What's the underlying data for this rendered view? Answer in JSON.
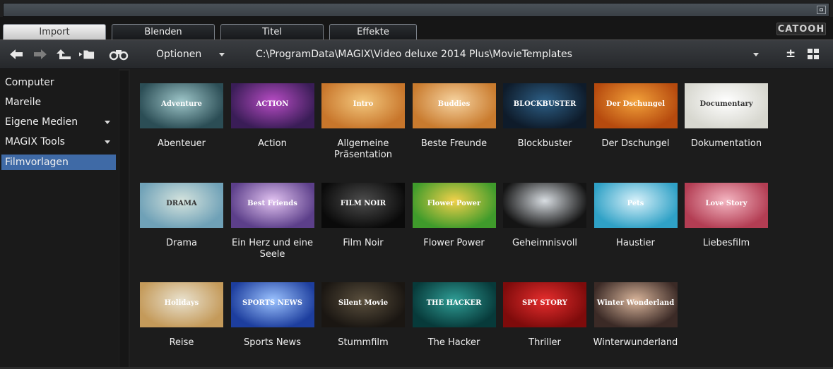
{
  "tabs": [
    "Import",
    "Blenden",
    "Titel",
    "Effekte"
  ],
  "logo": "CATOOH",
  "toolbar": {
    "options_label": "Optionen",
    "path": "C:\\ProgramData\\MAGIX\\Video deluxe 2014 Plus\\MovieTemplates"
  },
  "sidebar": {
    "items": [
      {
        "label": "Computer"
      },
      {
        "label": "Mareile"
      },
      {
        "label": "Eigene Medien"
      },
      {
        "label": "MAGIX Tools"
      },
      {
        "label": "Filmvorlagen"
      }
    ]
  },
  "templates": [
    {
      "caption": "Abenteuer",
      "thumb_text": "Adventure",
      "thumb_colors": [
        "#2b4d55",
        "#9ec6c9"
      ]
    },
    {
      "caption": "Action",
      "thumb_text": "ACTION",
      "thumb_colors": [
        "#3a1d57",
        "#b74cc4"
      ]
    },
    {
      "caption": "Allgemeine Präsentation",
      "thumb_text": "Intro",
      "thumb_colors": [
        "#c8762b",
        "#f3c77d"
      ]
    },
    {
      "caption": "Beste Freunde",
      "thumb_text": "Buddies",
      "thumb_colors": [
        "#c97b2e",
        "#f6d3a0"
      ]
    },
    {
      "caption": "Blockbuster",
      "thumb_text": "BLOCKBUSTER",
      "thumb_colors": [
        "#0e1b2a",
        "#2d5f86"
      ]
    },
    {
      "caption": "Der Dschungel",
      "thumb_text": "Der Dschungel",
      "thumb_colors": [
        "#b64a0e",
        "#f2a13a"
      ]
    },
    {
      "caption": "Dokumentation",
      "thumb_text": "Documentary",
      "thumb_colors": [
        "#d7d7cf",
        "#ffffff"
      ]
    },
    {
      "caption": "Drama",
      "thumb_text": "DRAMA",
      "thumb_colors": [
        "#6fa1b7",
        "#d6e4de"
      ]
    },
    {
      "caption": "Ein Herz und eine Seele",
      "thumb_text": "Best Friends",
      "thumb_colors": [
        "#5c3f8a",
        "#e2c3f1"
      ]
    },
    {
      "caption": "Film Noir",
      "thumb_text": "FILM NOIR",
      "thumb_colors": [
        "#0a0a0a",
        "#4d4d4d"
      ]
    },
    {
      "caption": "Flower Power",
      "thumb_text": "Flower Power",
      "thumb_colors": [
        "#3f9b2b",
        "#f2d14a"
      ]
    },
    {
      "caption": "Geheimnisvoll",
      "thumb_text": "",
      "thumb_colors": [
        "#141414",
        "#d8dde2"
      ]
    },
    {
      "caption": "Haustier",
      "thumb_text": "Pets",
      "thumb_colors": [
        "#2fa1c6",
        "#d8f1fa"
      ]
    },
    {
      "caption": "Liebesfilm",
      "thumb_text": "Love Story",
      "thumb_colors": [
        "#b33d53",
        "#f4b6c2"
      ]
    },
    {
      "caption": "Reise",
      "thumb_text": "Holidays",
      "thumb_colors": [
        "#c49a5a",
        "#e9e2cf"
      ]
    },
    {
      "caption": "Sports News",
      "thumb_text": "SPORTS NEWS",
      "thumb_colors": [
        "#1d3e9e",
        "#9cc3ff"
      ]
    },
    {
      "caption": "Stummfilm",
      "thumb_text": "Silent Movie",
      "thumb_colors": [
        "#1a1612",
        "#5a4f3d"
      ]
    },
    {
      "caption": "The Hacker",
      "thumb_text": "THE HACKER",
      "thumb_colors": [
        "#073a3a",
        "#2f9d95"
      ]
    },
    {
      "caption": "Thriller",
      "thumb_text": "SPY STORY",
      "thumb_colors": [
        "#7e0b0b",
        "#e52d2d"
      ]
    },
    {
      "caption": "Winterwunderland",
      "thumb_text": "Winter Wonderland",
      "thumb_colors": [
        "#3b2a26",
        "#d8b49a"
      ]
    }
  ],
  "colors": {
    "selected": "#3f6aa6",
    "active_tab": "#e0e0e0",
    "background": "#1c1c1c"
  }
}
